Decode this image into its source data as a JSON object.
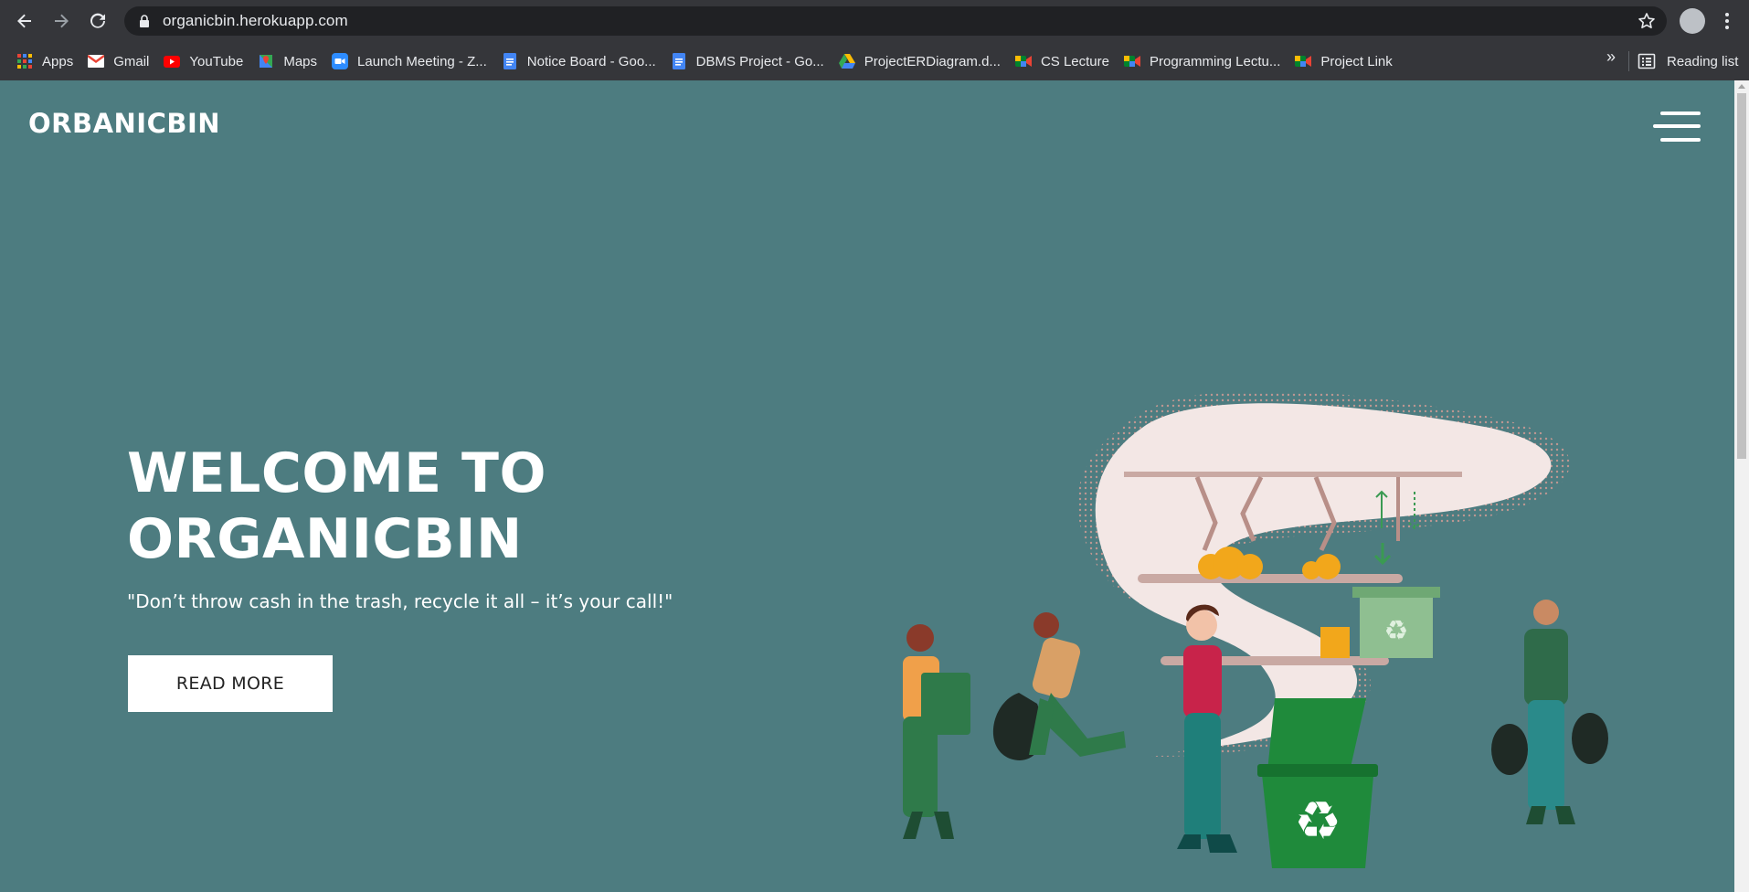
{
  "browser": {
    "url": "organicbin.herokuapp.com",
    "bookmarks": [
      {
        "label": "Apps",
        "icon": "apps-grid-icon"
      },
      {
        "label": "Gmail",
        "icon": "gmail-icon"
      },
      {
        "label": "YouTube",
        "icon": "youtube-icon"
      },
      {
        "label": "Maps",
        "icon": "maps-icon"
      },
      {
        "label": "Launch Meeting - Z...",
        "icon": "zoom-icon"
      },
      {
        "label": "Notice Board - Goo...",
        "icon": "google-docs-icon"
      },
      {
        "label": "DBMS Project - Go...",
        "icon": "google-docs-icon"
      },
      {
        "label": "ProjectERDiagram.d...",
        "icon": "google-drive-icon"
      },
      {
        "label": "CS Lecture",
        "icon": "google-meet-icon"
      },
      {
        "label": "Programming Lectu...",
        "icon": "google-meet-icon"
      },
      {
        "label": "Project Link",
        "icon": "google-meet-icon"
      }
    ],
    "overflow_label": "»",
    "reading_list_label": "Reading list"
  },
  "site": {
    "brand": "ORBANICBIN",
    "hero_title_line1": "WELCOME TO",
    "hero_title_line2": "ORGANICBIN",
    "tagline": "\"Don’t throw cash in the trash, recycle it all – it’s your call!\"",
    "read_more_label": "READ MORE"
  },
  "colors": {
    "page_background": "#4d7c80",
    "browser_toolbar": "#35363a",
    "omnibox": "#202124",
    "bin_green": "#1f8a3b"
  }
}
